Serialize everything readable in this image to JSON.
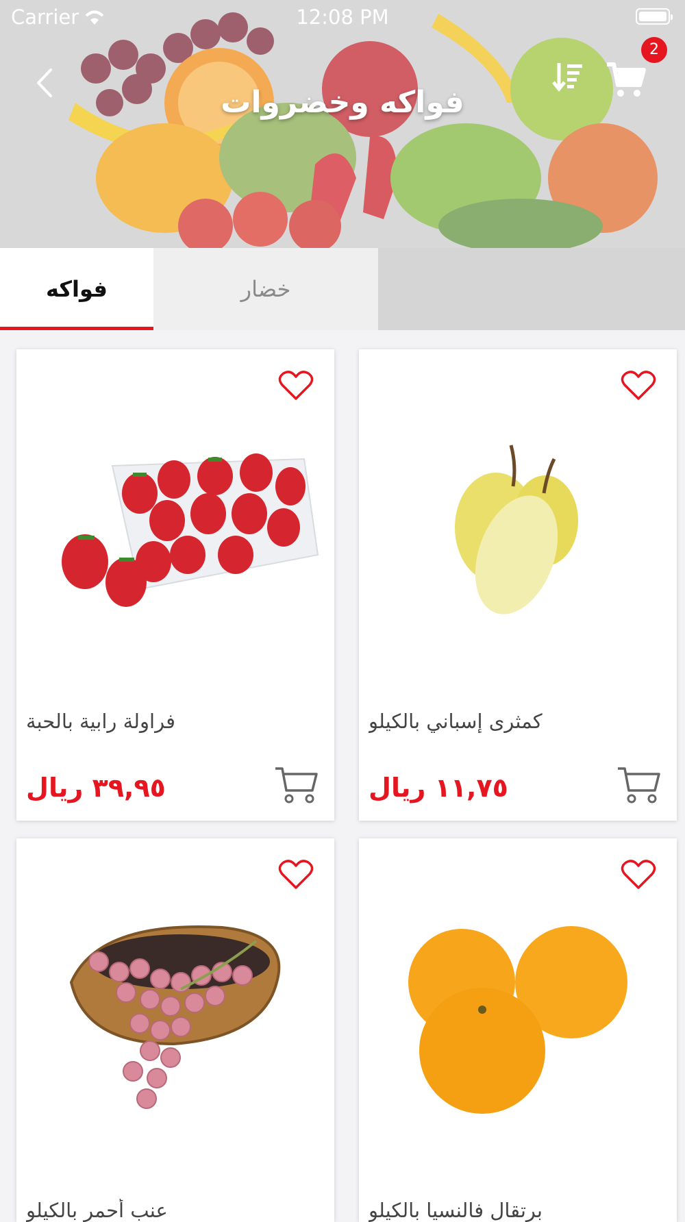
{
  "status_bar": {
    "carrier": "Carrier",
    "time": "12:08 PM"
  },
  "header": {
    "title": "فواكه وخضروات",
    "cart_count": "2"
  },
  "tabs": [
    {
      "label": "فواكه",
      "active": true
    },
    {
      "label": "خضار",
      "active": false
    }
  ],
  "colors": {
    "accent": "#e5161f",
    "price": "#e5161f"
  },
  "products": [
    {
      "name": "كمثرى إسباني بالكيلو",
      "price": "١١,٧٥ ريال",
      "image": "pears"
    },
    {
      "name": "فراولة رابية بالحبة",
      "price": "٣٩,٩٥ ريال",
      "image": "strawberries"
    },
    {
      "name": "برتقال فالنسيا بالكيلو",
      "price": "",
      "image": "oranges"
    },
    {
      "name": "عنب أحمر بالكيلو",
      "price": "",
      "image": "red-grapes"
    }
  ]
}
